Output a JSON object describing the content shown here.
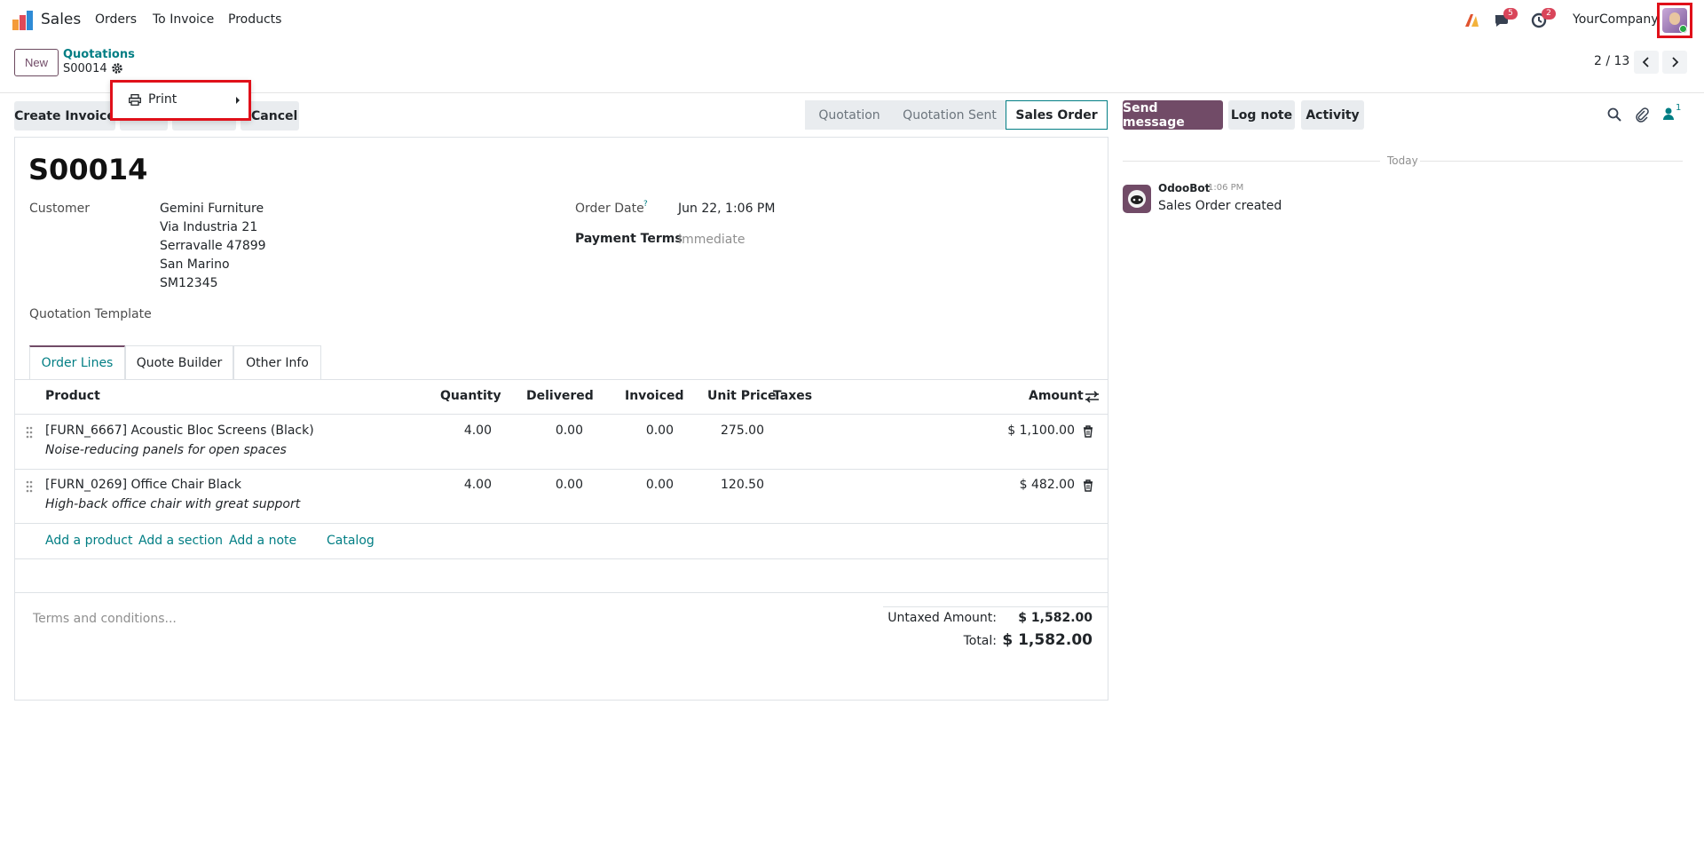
{
  "navbar": {
    "app_name": "Sales",
    "menu": [
      "Orders",
      "To Invoice",
      "Products"
    ],
    "messages_badge": "5",
    "activities_badge": "2",
    "company": "YourCompany"
  },
  "control_panel": {
    "new_label": "New",
    "breadcrumb_parent": "Quotations",
    "breadcrumb_current": "S00014",
    "pager": "2 / 13"
  },
  "actions": {
    "create_invoice": "Create Invoice",
    "cancel": "Cancel",
    "print_menu": {
      "print_label": "Print"
    }
  },
  "statusbar": [
    "Quotation",
    "Quotation Sent",
    "Sales Order"
  ],
  "chatter": {
    "send_message": "Send message",
    "log_note": "Log note",
    "activity": "Activity",
    "followers_count": "1",
    "day_label": "Today",
    "message": {
      "author": "OdooBot",
      "time": "1:06 PM",
      "body": "Sales Order created"
    }
  },
  "form": {
    "title": "S00014",
    "customer_label": "Customer",
    "customer_name": "Gemini Furniture",
    "address": [
      "Via Industria 21",
      "Serravalle 47899",
      "San Marino",
      "SM12345"
    ],
    "order_date_label": "Order Date",
    "order_date_help": "?",
    "order_date": "Jun 22, 1:06 PM",
    "payment_terms_label": "Payment Terms",
    "payment_terms": "Immediate",
    "quotation_template_label": "Quotation Template",
    "tabs": [
      "Order Lines",
      "Quote Builder",
      "Other Info"
    ],
    "columns": {
      "product": "Product",
      "quantity": "Quantity",
      "delivered": "Delivered",
      "invoiced": "Invoiced",
      "unit_price": "Unit Price",
      "taxes": "Taxes",
      "amount": "Amount"
    },
    "lines": [
      {
        "product": "[FURN_6667] Acoustic Bloc Screens (Black)",
        "description": "Noise-reducing panels for open spaces",
        "quantity": "4.00",
        "delivered": "0.00",
        "invoiced": "0.00",
        "unit_price": "275.00",
        "amount": "$ 1,100.00"
      },
      {
        "product": "[FURN_0269] Office Chair Black",
        "description": "High-back office chair with great support",
        "quantity": "4.00",
        "delivered": "0.00",
        "invoiced": "0.00",
        "unit_price": "120.50",
        "amount": "$ 482.00"
      }
    ],
    "add_links": [
      "Add a product",
      "Add a section",
      "Add a note",
      "Catalog"
    ],
    "terms_placeholder": "Terms and conditions...",
    "untaxed_label": "Untaxed Amount:",
    "untaxed_value": "$ 1,582.00",
    "total_label": "Total:",
    "total_value": "$ 1,582.00"
  },
  "icons": [
    "app-logo-icon",
    "chat-icon",
    "clock-icon",
    "gear-icon",
    "chevron-left-icon",
    "chevron-right-icon",
    "printer-icon",
    "search-icon",
    "paperclip-icon",
    "user-icon",
    "drag-handle-icon",
    "trash-icon",
    "settings-toggle-icon"
  ],
  "colors": {
    "brand": "#714b67",
    "link": "#017e84",
    "highlight": "#e0101a",
    "badge": "#d9455a"
  }
}
